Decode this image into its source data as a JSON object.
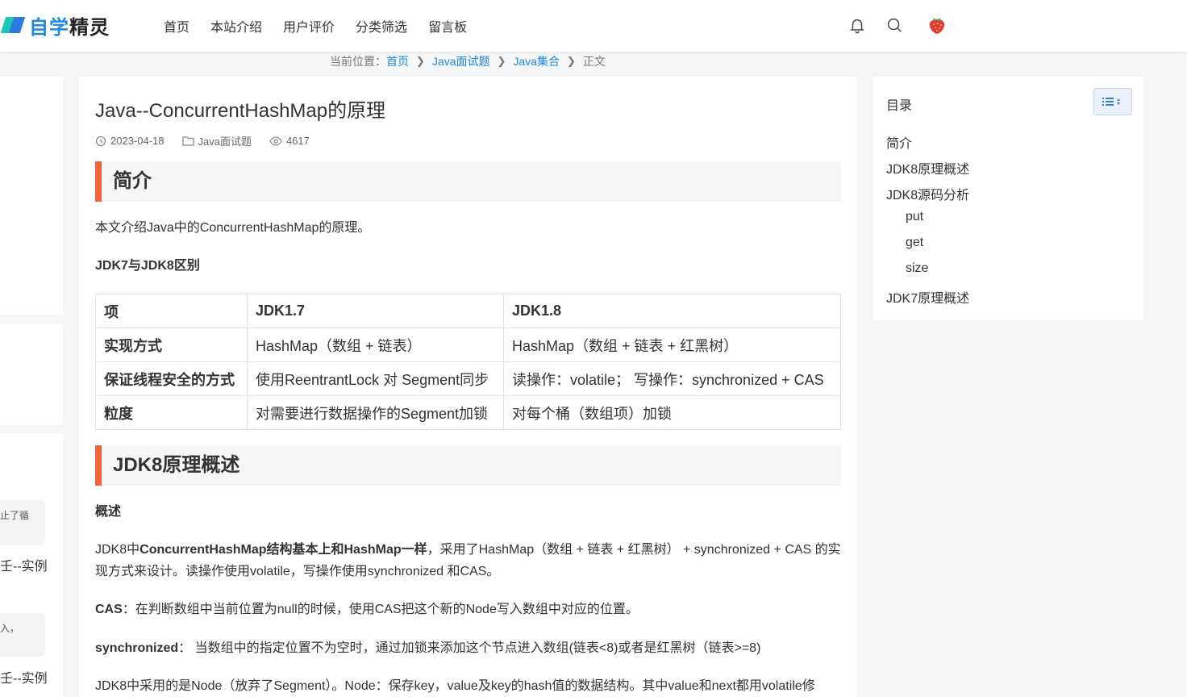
{
  "header": {
    "logo_text_1": "自学",
    "logo_text_2": "精灵",
    "nav": [
      "首页",
      "本站介绍",
      "用户评价",
      "分类筛选",
      "留言板"
    ]
  },
  "breadcrumb": {
    "prefix": "当前位置：",
    "items": [
      "首页",
      "Java面试题",
      "Java集合"
    ],
    "current": "正文"
  },
  "left_sidebar": {
    "box1_text": "止了循",
    "text1": "壬--实例",
    "box2_text": "入，",
    "text2": "壬--实例"
  },
  "article": {
    "title": "Java--ConcurrentHashMap的原理",
    "date": "2023-04-18",
    "category": "Java面试题",
    "views": "4617",
    "section1": "简介",
    "intro": "本文介绍Java中的ConcurrentHashMap的原理。",
    "compare_heading": "JDK7与JDK8区别",
    "table": {
      "headers": [
        "项",
        "JDK1.7",
        "JDK1.8"
      ],
      "rows": [
        [
          "实现方式",
          "HashMap（数组 + 链表）",
          "HashMap（数组 + 链表 + 红黑树）"
        ],
        [
          "保证线程安全的方式",
          "使用ReentrantLock 对 Segment同步",
          "读操作：volatile； 写操作：synchronized + CAS"
        ],
        [
          "粒度",
          "对需要进行数据操作的Segment加锁",
          "对每个桶（数组项）加锁"
        ]
      ]
    },
    "section2": "JDK8原理概述",
    "overview_label": "概述",
    "para1_pre": "JDK8中",
    "para1_bold": "ConcurrentHashMap结构基本上和HashMap一样",
    "para1_post": "，采用了HashMap（数组 + 链表 + 红黑树） + synchronized + CAS 的实现方式来设计。读操作使用volatile，写操作使用synchronized 和CAS。",
    "cas_label": "CAS",
    "cas_text": "：在判断数组中当前位置为null的时候，使用CAS把这个新的Node写入数组中对应的位置。",
    "sync_label": "synchronized",
    "sync_text": "： 当数组中的指定位置不为空时，通过加锁来添加这个节点进入数组(链表<8)或者是红黑树（链表>=8)",
    "para_last": "JDK8中采用的是Node（放弃了Segment）。Node：保存key，value及key的hash值的数据结构。其中value和next都用volatile修"
  },
  "toc": {
    "title": "目录",
    "items": [
      "简介",
      "JDK8原理概述",
      "JDK8源码分析",
      "put",
      "get",
      "size",
      "JDK7原理概述"
    ]
  },
  "colors": {
    "accent": "#f0643a",
    "link": "#1e88e5",
    "logo_teal": "#1fc7b6",
    "logo_blue": "#2e7be0"
  }
}
